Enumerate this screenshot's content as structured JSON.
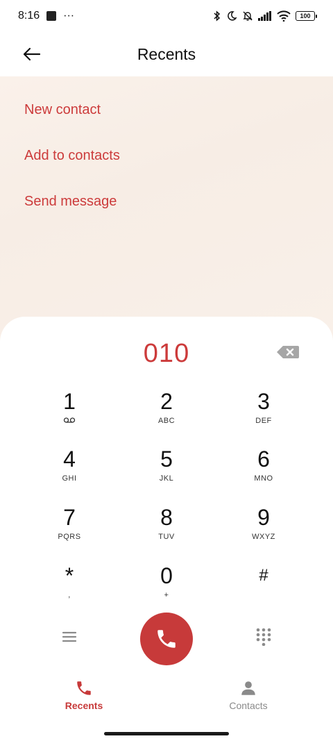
{
  "status_bar": {
    "time": "8:16",
    "overflow": "···",
    "battery": "100",
    "icons": [
      "bluetooth-icon",
      "moon-icon",
      "bell-off-icon",
      "signal-icon",
      "wifi-icon",
      "battery-icon"
    ]
  },
  "header": {
    "title": "Recents",
    "back_icon": "back-arrow-icon"
  },
  "actions": [
    "New contact",
    "Add to contacts",
    "Send message"
  ],
  "dialer": {
    "number": "010",
    "keys": [
      {
        "digit": "1",
        "letters": "voicemail-icon"
      },
      {
        "digit": "2",
        "letters": "ABC"
      },
      {
        "digit": "3",
        "letters": "DEF"
      },
      {
        "digit": "4",
        "letters": "GHI"
      },
      {
        "digit": "5",
        "letters": "JKL"
      },
      {
        "digit": "6",
        "letters": "MNO"
      },
      {
        "digit": "7",
        "letters": "PQRS"
      },
      {
        "digit": "8",
        "letters": "TUV"
      },
      {
        "digit": "9",
        "letters": "WXYZ"
      },
      {
        "digit": "*",
        "letters": ","
      },
      {
        "digit": "0",
        "letters": "+"
      },
      {
        "digit": "#",
        "letters": ""
      }
    ]
  },
  "tabs": [
    {
      "label": "Recents",
      "icon": "phone-icon",
      "active": true
    },
    {
      "label": "Contacts",
      "icon": "person-icon",
      "active": false
    }
  ],
  "colors": {
    "accent": "#c73a3a",
    "accent_text": "#cc3b3b",
    "inactive": "#8a8a8a",
    "actions_bg": "#f8efe8"
  }
}
